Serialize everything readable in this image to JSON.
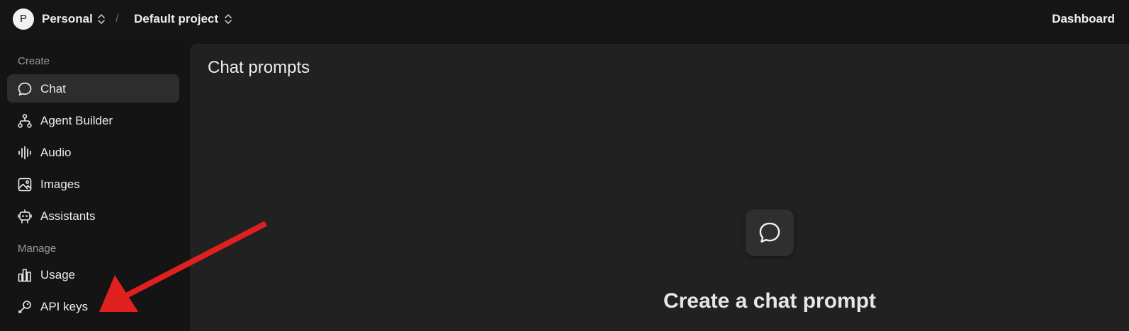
{
  "header": {
    "avatar_initial": "P",
    "org_label": "Personal",
    "separator": "/",
    "project_label": "Default project",
    "dashboard_link": "Dashboard"
  },
  "sidebar": {
    "create_heading": "Create",
    "manage_heading": "Manage",
    "items": [
      {
        "label": "Chat",
        "icon": "chat-bubble-icon",
        "active": true
      },
      {
        "label": "Agent Builder",
        "icon": "agent-builder-icon",
        "active": false
      },
      {
        "label": "Audio",
        "icon": "audio-waveform-icon",
        "active": false
      },
      {
        "label": "Images",
        "icon": "image-icon",
        "active": false
      },
      {
        "label": "Assistants",
        "icon": "robot-icon",
        "active": false
      },
      {
        "label": "Usage",
        "icon": "bar-chart-icon",
        "active": false
      },
      {
        "label": "API keys",
        "icon": "key-icon",
        "active": false
      }
    ]
  },
  "main": {
    "title": "Chat prompts",
    "empty_state": {
      "icon": "chat-bubble-icon",
      "heading": "Create a chat prompt"
    }
  },
  "annotation": {
    "arrow_color": "#e0201f",
    "points_to": "API keys"
  },
  "colors": {
    "background": "#141414",
    "panel": "#212121",
    "active_item": "#2d2d2d",
    "text": "#ececec",
    "muted_text": "#9a9a9a"
  }
}
